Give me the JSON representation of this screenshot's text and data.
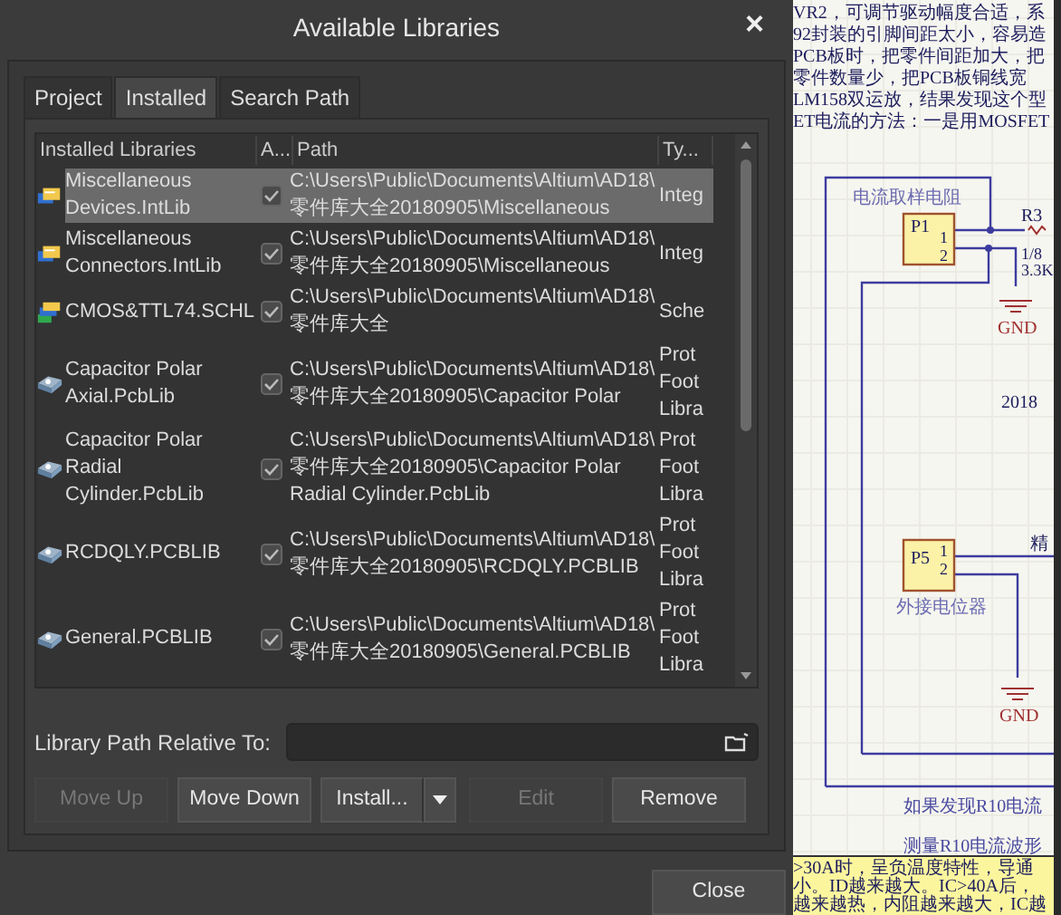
{
  "window": {
    "title": "Available Libraries",
    "close_glyph": "×"
  },
  "tabs": [
    {
      "label": "Project",
      "selected": false
    },
    {
      "label": "Installed",
      "selected": true
    },
    {
      "label": "Search Path",
      "selected": false
    }
  ],
  "table": {
    "columns": [
      "Installed Libraries",
      "A...",
      "Path",
      "Ty..."
    ],
    "rows": [
      {
        "kind": "integrated",
        "name_lines": [
          "Miscellaneous",
          "Devices.IntLib"
        ],
        "checked": true,
        "path_lines": [
          "C:\\Users\\Public\\Documents\\Altium\\AD18\\",
          "零件库大全20180905\\Miscellaneous"
        ],
        "type_lines": [
          "Integ"
        ],
        "selected": true
      },
      {
        "kind": "integrated",
        "name_lines": [
          "Miscellaneous",
          "Connectors.IntLib"
        ],
        "checked": true,
        "path_lines": [
          "C:\\Users\\Public\\Documents\\Altium\\AD18\\",
          "零件库大全20180905\\Miscellaneous"
        ],
        "type_lines": [
          "Integ"
        ],
        "selected": false
      },
      {
        "kind": "schematic",
        "name_lines": [
          "CMOS&TTL74.SCHL"
        ],
        "checked": true,
        "path_lines": [
          "C:\\Users\\Public\\Documents\\Altium\\AD18\\",
          "零件库大全"
        ],
        "type_lines": [
          "Sche"
        ],
        "selected": false
      },
      {
        "kind": "pcb",
        "name_lines": [
          "Capacitor Polar",
          "Axial.PcbLib"
        ],
        "checked": true,
        "path_lines": [
          "C:\\Users\\Public\\Documents\\Altium\\AD18\\",
          "零件库大全20180905\\Capacitor Polar"
        ],
        "type_lines": [
          "Prot",
          "Foot",
          "Libra"
        ],
        "selected": false
      },
      {
        "kind": "pcb",
        "name_lines": [
          "Capacitor Polar",
          "Radial",
          "Cylinder.PcbLib"
        ],
        "checked": true,
        "path_lines": [
          "C:\\Users\\Public\\Documents\\Altium\\AD18\\",
          "零件库大全20180905\\Capacitor Polar",
          "Radial Cylinder.PcbLib"
        ],
        "type_lines": [
          "Prot",
          "Foot",
          "Libra"
        ],
        "selected": false
      },
      {
        "kind": "pcb",
        "name_lines": [
          "RCDQLY.PCBLIB"
        ],
        "checked": true,
        "path_lines": [
          "C:\\Users\\Public\\Documents\\Altium\\AD18\\",
          "零件库大全20180905\\RCDQLY.PCBLIB"
        ],
        "type_lines": [
          "Prot",
          "Foot",
          "Libra"
        ],
        "selected": false
      },
      {
        "kind": "pcb",
        "name_lines": [
          "General.PCBLIB"
        ],
        "checked": true,
        "path_lines": [
          "C:\\Users\\Public\\Documents\\Altium\\AD18\\",
          "零件库大全20180905\\General.PCBLIB"
        ],
        "type_lines": [
          "Prot",
          "Foot",
          "Libra"
        ],
        "selected": false
      }
    ]
  },
  "relative_path": {
    "label": "Library Path Relative To:"
  },
  "buttons": [
    {
      "label": "Move Up",
      "disabled": true,
      "kind": "plain"
    },
    {
      "label": "Move Down",
      "disabled": false,
      "kind": "plain"
    },
    {
      "label": "Install...",
      "disabled": false,
      "kind": "split"
    },
    {
      "label": "Edit",
      "disabled": true,
      "kind": "plain"
    },
    {
      "label": "Remove",
      "disabled": false,
      "kind": "plain"
    }
  ],
  "close_button": {
    "label": "Close"
  },
  "schematic": {
    "notes": [
      "VR2，可调节驱动幅度合适，系",
      "92封装的引脚间距太小，容易造",
      "PCB板时，把零件间距加大，把",
      "零件数量少，把PCB板铜线宽",
      "LM158双运放，结果发现这个型",
      "ET电流的方法：一是用MOSFET"
    ],
    "parts": [
      {
        "designator": "P1",
        "pins": [
          "1",
          "2"
        ],
        "caption": "电流取样电阻"
      },
      {
        "designator": "P5",
        "pins": [
          "1",
          "2"
        ],
        "caption": "外接电位器"
      }
    ],
    "resistor": {
      "designator": "R3",
      "values": [
        "1/8",
        "3.3K"
      ]
    },
    "grounds": [
      "GND",
      "GND"
    ],
    "labels": [
      "2018",
      "精"
    ],
    "remarks": [
      "如果发现R10电流",
      "测量R10电流波形"
    ],
    "yellow_note": [
      ">30A时，呈负温度特性，导通",
      "小。ID越来越大。IC>40A后，",
      "越来越热，内阻越来越大，IC越"
    ]
  }
}
